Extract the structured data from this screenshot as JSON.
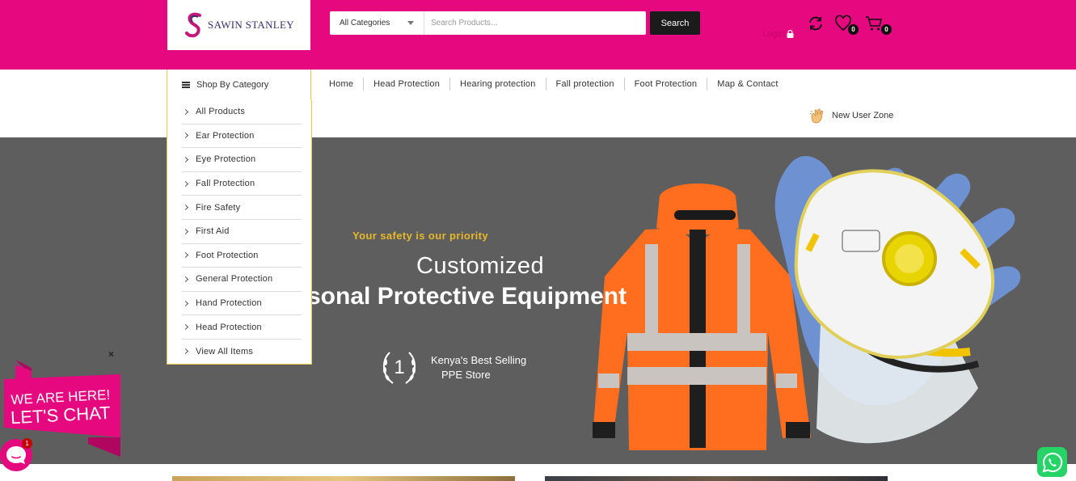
{
  "brand": {
    "logo_text": "SAWIN STANLEY"
  },
  "search": {
    "category": "All Categories",
    "placeholder": "Search Products...",
    "button": "Search"
  },
  "account": {
    "login": "Login",
    "wishlist_count": "0",
    "cart_count": "0"
  },
  "nav": {
    "shop_by_category": "Shop By Category",
    "links": [
      "Home",
      "Head Protection",
      "Hearing protection",
      "Fall protection",
      "Foot Protection",
      "Map & Contact"
    ],
    "new_user_zone": "New User Zone"
  },
  "categories": [
    "All Products",
    "Ear Protection",
    "Eye Protection",
    "Fall Protection",
    "Fire Safety",
    "First Aid",
    "Foot Protection",
    "General Protection",
    "Hand Protection",
    "Head Protection",
    "View All Items"
  ],
  "hero": {
    "tagline": "Your safety is our priority",
    "heading_line1": "Customized",
    "heading_line2": "sonal Protective Equipment",
    "award_number": "1",
    "award_line1": "Kenya's Best Selling",
    "award_line2": "PPE Store"
  },
  "chat": {
    "line1": "WE ARE HERE!",
    "line2": "LET'S CHAT",
    "unread": "1",
    "close": "×"
  },
  "colors": {
    "brand_pink": "#e5087e",
    "accent_yellow": "#e8b82a",
    "hero_bg": "#5e5e5e",
    "whatsapp": "#25d366"
  }
}
